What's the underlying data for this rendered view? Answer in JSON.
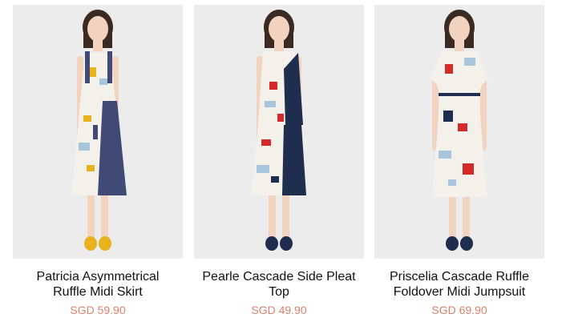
{
  "products": [
    {
      "title_line1": "Patricia Asymmetrical",
      "title_line2": "Ruffle Midi Skirt",
      "price": "SGD 59.90",
      "shoe_color": "#e8b21f",
      "skirt_accent": "#3f4b76"
    },
    {
      "title_line1": "Pearle Cascade Side Pleat",
      "title_line2": "Top",
      "price": "SGD 49.90",
      "shoe_color": "#1f2d4f",
      "skirt_accent": "#1f2d4f"
    },
    {
      "title_line1": "Priscelia Cascade Ruffle",
      "title_line2": "Foldover Midi Jumpsuit",
      "price": "SGD 69.90",
      "shoe_color": "#1f2d4f",
      "skirt_accent": "#d42a2a"
    }
  ]
}
